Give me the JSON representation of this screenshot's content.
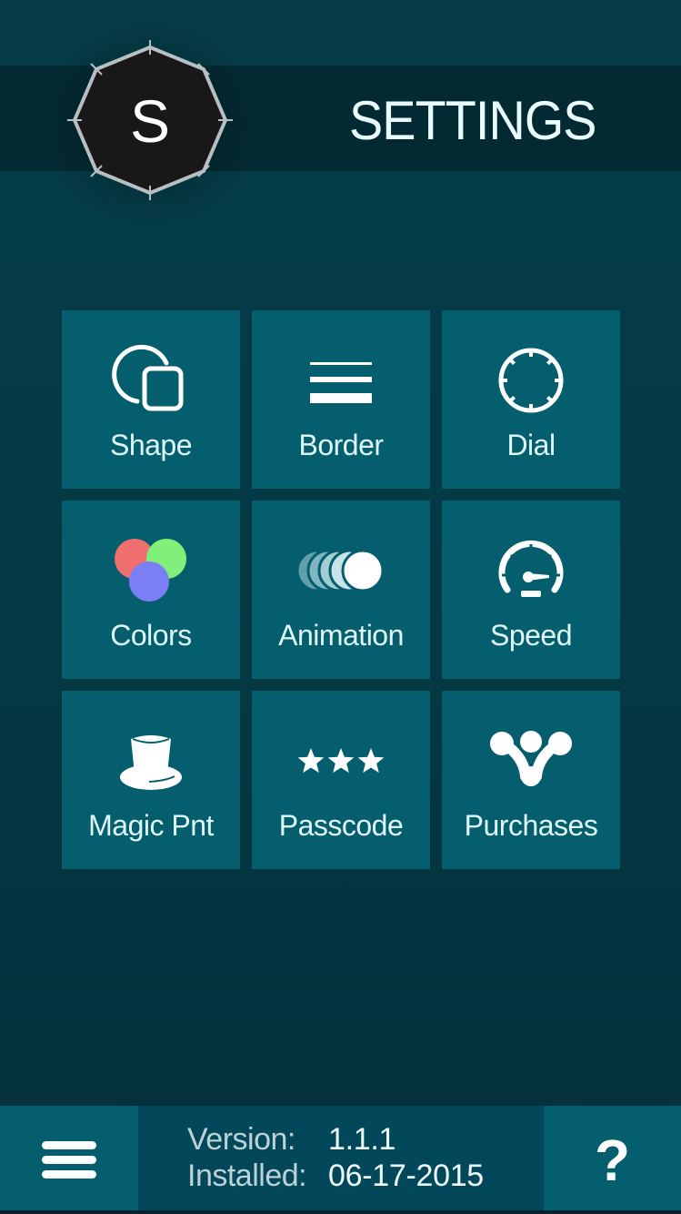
{
  "header": {
    "logo_letter": "S",
    "title": "SETTINGS"
  },
  "tiles": [
    {
      "id": "shape",
      "label": "Shape",
      "icon": "shape-icon"
    },
    {
      "id": "border",
      "label": "Border",
      "icon": "border-icon"
    },
    {
      "id": "dial",
      "label": "Dial",
      "icon": "dial-icon"
    },
    {
      "id": "colors",
      "label": "Colors",
      "icon": "colors-icon"
    },
    {
      "id": "animation",
      "label": "Animation",
      "icon": "animation-icon"
    },
    {
      "id": "speed",
      "label": "Speed",
      "icon": "speedometer-icon"
    },
    {
      "id": "magic-pnt",
      "label": "Magic Pnt",
      "icon": "top-hat-icon"
    },
    {
      "id": "passcode",
      "label": "Passcode",
      "icon": "stars-icon"
    },
    {
      "id": "purchases",
      "label": "Purchases",
      "icon": "purchases-icon"
    }
  ],
  "colors": {
    "tile_bg": "#045e6d",
    "background": "#043a45",
    "header_band": "#032a33",
    "swatch_red": "#f07070",
    "swatch_green": "#80f07a",
    "swatch_blue": "#7b7ff5"
  },
  "footer": {
    "menu_icon": "hamburger-menu-icon",
    "version_label": "Version:",
    "version_value": "1.1.1",
    "installed_label": "Installed:",
    "installed_value": "06-17-2015",
    "help_glyph": "?"
  }
}
